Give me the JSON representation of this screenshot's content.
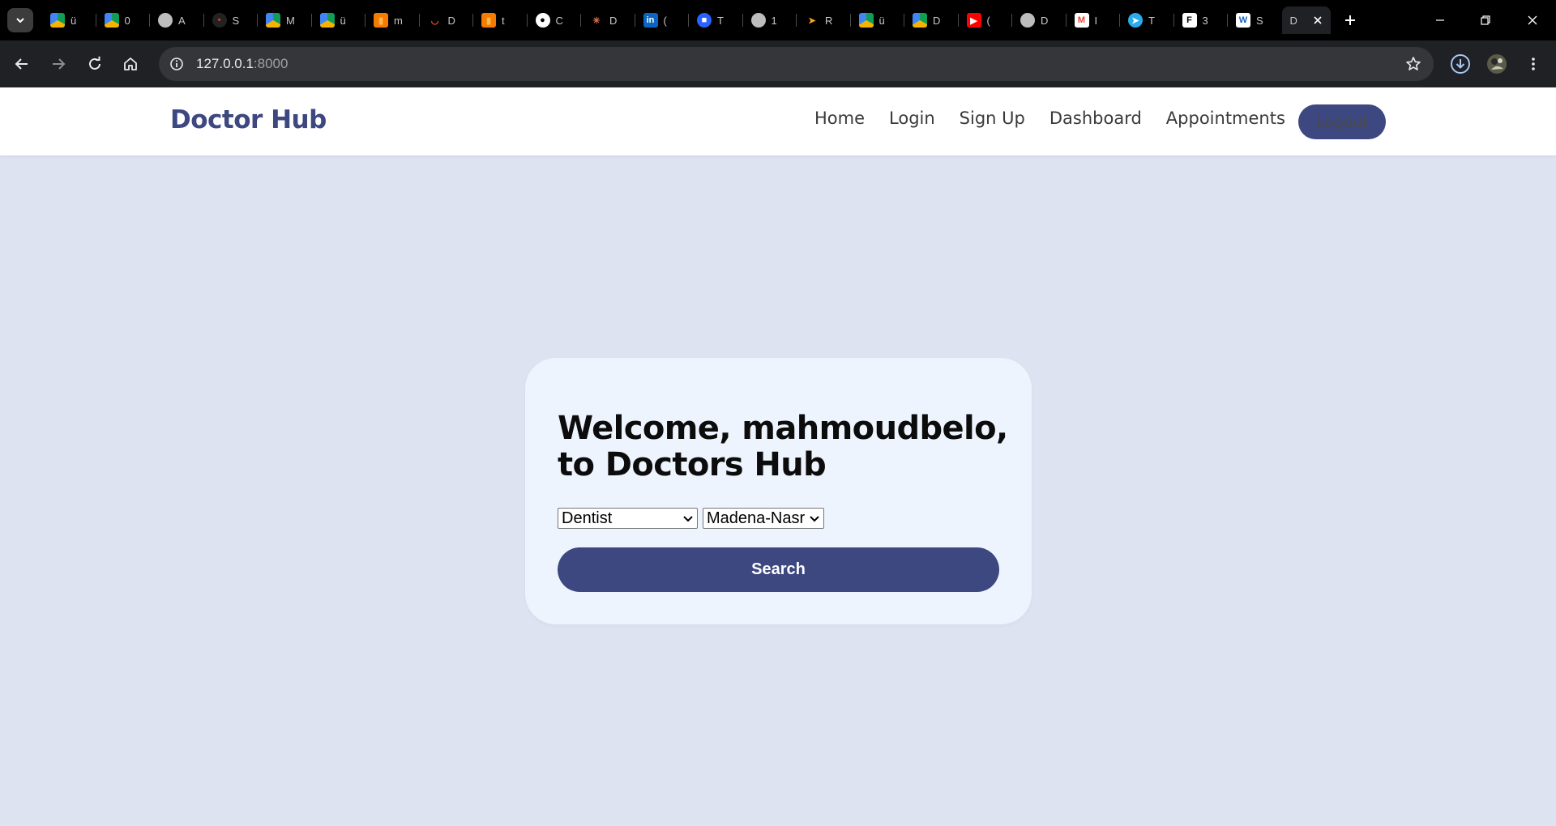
{
  "browser": {
    "tabs": [
      {
        "icon": "google-drive-icon",
        "title": "ü"
      },
      {
        "icon": "google-drive-icon",
        "title": "0"
      },
      {
        "icon": "globe-icon",
        "title": "A"
      },
      {
        "icon": "amit-logo-icon",
        "title": "S"
      },
      {
        "icon": "google-drive-icon",
        "title": "M"
      },
      {
        "icon": "google-drive-icon",
        "title": "ü"
      },
      {
        "icon": "book-icon",
        "title": "m"
      },
      {
        "icon": "circle-swoosh-icon",
        "title": "D"
      },
      {
        "icon": "book-icon",
        "title": "t"
      },
      {
        "icon": "github-icon",
        "title": "C"
      },
      {
        "icon": "claude-sparkle-icon",
        "title": "D"
      },
      {
        "icon": "linkedin-icon",
        "title": "("
      },
      {
        "icon": "translate-icon",
        "title": "T"
      },
      {
        "icon": "globe-icon",
        "title": "1"
      },
      {
        "icon": "arrow-logo-icon",
        "title": "R"
      },
      {
        "icon": "google-drive-icon",
        "title": "ü"
      },
      {
        "icon": "google-drive-icon",
        "title": "D"
      },
      {
        "icon": "youtube-icon",
        "title": "("
      },
      {
        "icon": "globe-icon",
        "title": "D"
      },
      {
        "icon": "gmail-icon",
        "title": "I"
      },
      {
        "icon": "telegram-icon",
        "title": "T"
      },
      {
        "icon": "figma-icon",
        "title": "3"
      },
      {
        "icon": "w3schools-icon",
        "title": "S"
      }
    ],
    "active_tab_title": "D",
    "url_host": "127.0.0.1",
    "url_port": ":8000"
  },
  "navbar": {
    "brand": "Doctor Hub",
    "links": [
      "Home",
      "Login",
      "Sign Up",
      "Dashboard",
      "Appointments"
    ],
    "logout_label": "Logout"
  },
  "card": {
    "welcome_line1": "Welcome, mahmoudbelo,",
    "welcome_line2": "to Doctors Hub",
    "specialty_value": "Dentist",
    "location_value": "Madena-Nasr",
    "search_label": "Search"
  },
  "colors": {
    "brand": "#3d4780",
    "page_bg": "#dee3f2",
    "card_bg": "#eef4fe"
  }
}
